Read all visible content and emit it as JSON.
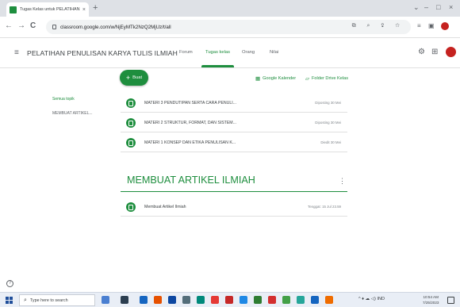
{
  "browser": {
    "tab_title": "Tugas Kelas untuk PELATIHAN PE",
    "tab_close": "×",
    "new_tab": "+",
    "minimize": "–",
    "maximize": "□",
    "close": "×",
    "back": "←",
    "forward": "→",
    "reload": "C",
    "url": "classroom.google.com/w/NjEyMTk2NzQ2MjUz/t/all"
  },
  "app": {
    "menu_icon": "≡",
    "class_name": "PELATIHAN PENULISAN KARYA TULIS ILMIAH",
    "tabs": [
      {
        "label": "Forum"
      },
      {
        "label": "Tugas kelas"
      },
      {
        "label": "Orang"
      },
      {
        "label": "Nilai"
      }
    ],
    "settings_icon": "⚙",
    "apps_icon": "⋮⋮⋮"
  },
  "toolbar": {
    "create_label": "Buat",
    "create_plus": "+",
    "calendar_label": "Google Kalender",
    "drive_label": "Folder Drive Kelas"
  },
  "sidebar": {
    "items": [
      {
        "label": "Semua topik"
      },
      {
        "label": "MEMBUAT ARTIKEL..."
      }
    ]
  },
  "materials": [
    {
      "title": "MATERI 3 PENDUTIPAN SERTA CARA PENULI...",
      "date": "Diposting 30 Mei"
    },
    {
      "title": "MATERI 2 STRUKTUR, FORMAT, DAN SISTEM...",
      "date": "Diposting 30 Mei"
    },
    {
      "title": "MATERI 1 KONSEP DAN ETIKA PENULISAN K...",
      "date": "Diedit 30 Mei"
    }
  ],
  "topic": {
    "title": "MEMBUAT ARTIKEL ILMIAH",
    "menu": "⋮",
    "items": [
      {
        "title": "Membuat Artikel Ilmiah",
        "date": "Tenggat: 15 Jul 23.59"
      }
    ]
  },
  "help_icon": "?",
  "taskbar": {
    "search_placeholder": "Type here to search",
    "tray_text": "^  ♦  ☁  ◁)  IND",
    "time": "10:54 AM",
    "date": "7/25/2023"
  },
  "colors": {
    "accent": "#1e8e3e",
    "text": "#3c4043",
    "muted": "#80868b"
  }
}
